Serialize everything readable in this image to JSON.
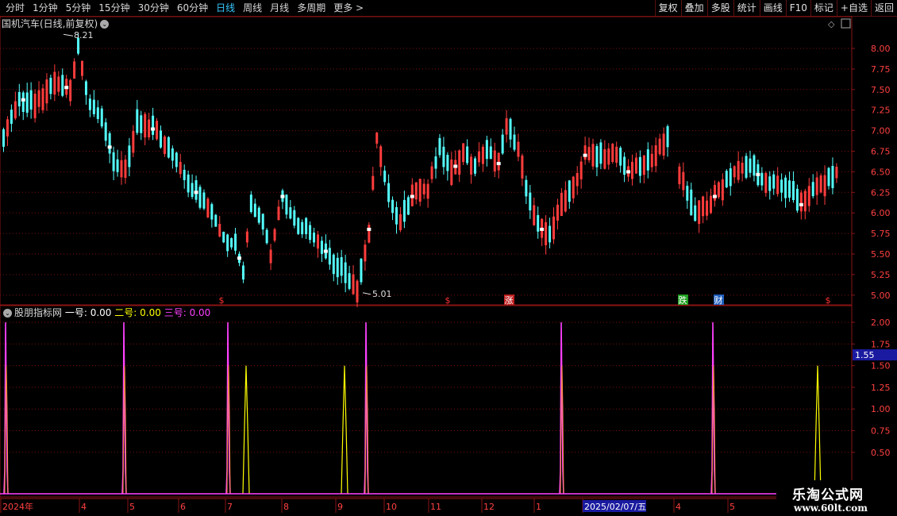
{
  "toolbar": {
    "periods": [
      "分时",
      "1分钟",
      "5分钟",
      "15分钟",
      "30分钟",
      "60分钟",
      "日线",
      "周线",
      "月线",
      "多周期",
      "更多"
    ],
    "active": "日线",
    "more_arrow": ">",
    "buttons": [
      "复权",
      "叠加",
      "多股",
      "统计",
      "画线",
      "F10",
      "标记",
      "+自选",
      "返回"
    ]
  },
  "main_chart": {
    "title": "国机汽车(日线,前复权)",
    "high_label": "8.21",
    "low_label": "5.01",
    "y_ticks": [
      "8.00",
      "7.75",
      "7.50",
      "7.25",
      "7.00",
      "6.75",
      "6.50",
      "6.25",
      "6.00",
      "5.75",
      "5.50",
      "5.25",
      "5.00"
    ],
    "markers": [
      {
        "text": "$",
        "color": "#ff3030",
        "bg": "#000"
      },
      {
        "text": "$",
        "color": "#ff3030",
        "bg": "#000"
      },
      {
        "text": "涨",
        "color": "#ffffff",
        "bg": "#c02020"
      },
      {
        "text": "跌",
        "color": "#ffffff",
        "bg": "#20a020"
      },
      {
        "text": "财",
        "color": "#ffffff",
        "bg": "#2060c0"
      },
      {
        "text": "$",
        "color": "#ff3030",
        "bg": "#000"
      }
    ]
  },
  "indicator": {
    "name": "股朋指标网",
    "s1_label": "一号:",
    "s1_value": "0.00",
    "s2_label": "二号:",
    "s2_value": "0.00",
    "s3_label": "三号:",
    "s3_value": "0.00",
    "y_ticks": [
      "2.00",
      "1.75",
      "1.50",
      "1.25",
      "1.00",
      "0.75",
      "0.50"
    ],
    "cursor_value": "1.55",
    "colors": {
      "s1": "#ffffff",
      "s2": "#ffff00",
      "s3": "#ff40ff",
      "orange": "#ff8c40"
    }
  },
  "x_axis": {
    "labels": [
      "2024年",
      "4",
      "5",
      "6",
      "7",
      "8",
      "9",
      "10",
      "11",
      "12",
      "1",
      "2025/02/07/五",
      "4",
      "5"
    ]
  },
  "watermark": {
    "line1": "乐淘公式网",
    "line2": "www.60lt.com"
  },
  "colors": {
    "up": "#ff3c3c",
    "down": "#54ffff",
    "grid": "#7a0f0f",
    "axis_text": "#ff4040",
    "white_marker": "#ffffff"
  }
}
